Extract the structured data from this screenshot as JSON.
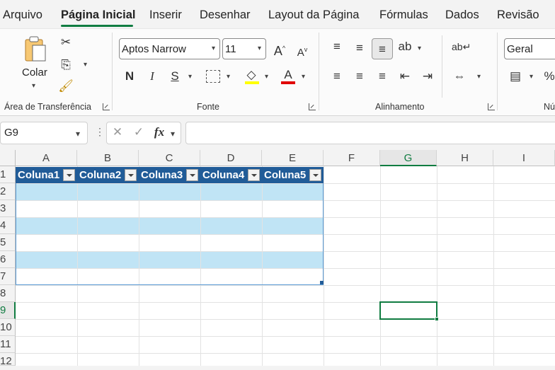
{
  "menu": {
    "tabs": [
      "Arquivo",
      "Página Inicial",
      "Inserir",
      "Desenhar",
      "Layout da Página",
      "Fórmulas",
      "Dados",
      "Revisão"
    ],
    "active_tab": "Página Inicial"
  },
  "ribbon": {
    "clipboard": {
      "paste_label": "Colar",
      "group_label": "Área de Transferência"
    },
    "font": {
      "font_name": "Aptos Narrow",
      "font_size": "11",
      "group_label": "Fonte",
      "bold": "N",
      "italic": "I",
      "underline": "S",
      "fill_color": "#ffff00",
      "font_color": "#e00000"
    },
    "alignment": {
      "group_label": "Alinhamento"
    },
    "number": {
      "format": "Geral",
      "group_label": "Nú"
    }
  },
  "formula_bar": {
    "name_box": "G9",
    "fx": "fx",
    "content": ""
  },
  "sheet": {
    "columns": [
      "A",
      "B",
      "C",
      "D",
      "E",
      "F",
      "G",
      "H",
      "I"
    ],
    "rows": [
      "1",
      "2",
      "3",
      "4",
      "5",
      "6",
      "7",
      "8",
      "9",
      "10",
      "11",
      "12"
    ],
    "selected_cell": "G9",
    "table_headers": [
      "Coluna1",
      "Coluna2",
      "Coluna3",
      "Coluna4",
      "Coluna5"
    ],
    "table_header_color": "#215c98",
    "table_band_color": "#c0e4f5"
  }
}
